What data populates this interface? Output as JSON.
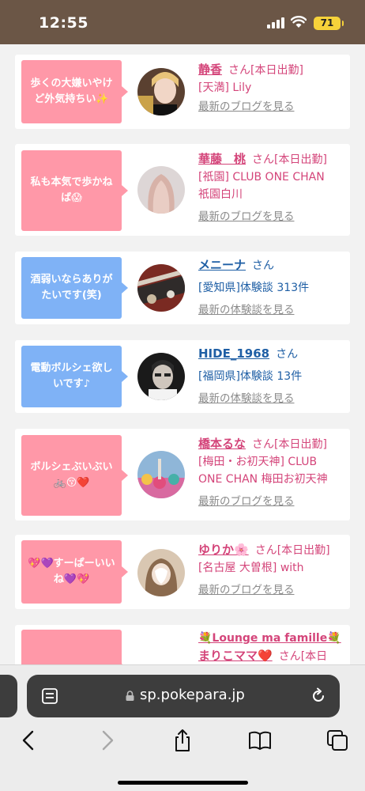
{
  "status": {
    "time": "12:55",
    "battery": "71"
  },
  "cards": [
    {
      "bubble": "歩くの大嫌いやけど外気持ちい✨",
      "name": "静香",
      "san": "さん",
      "tag": "[本日出勤]",
      "store": "[天満] Lily",
      "link": "最新のブログを見る"
    },
    {
      "bubble": "私も本気で歩かねば😱",
      "name": "華藤　桃",
      "san": "さん",
      "tag": "[本日出勤]",
      "store": "[祇園] CLUB ONE CHAN 祇園白川",
      "link": "最新のブログを見る"
    },
    {
      "bubble": "酒弱いならありがたいです(笑)",
      "name": "メニーナ",
      "san": "さん",
      "store": "[愛知県]体験談 313件",
      "link": "最新の体験談を見る"
    },
    {
      "bubble": "電動ボルシェ欲しいです♪",
      "name": "HIDE_1968",
      "san": "さん",
      "store": "[福岡県]体験談 13件",
      "link": "最新の体験談を見る"
    },
    {
      "bubble": "ボルシェぶいぶい🚲😚❤️",
      "name": "橋本るな",
      "san": "さん",
      "tag": "[本日出勤]",
      "store": "[梅田・お初天神] CLUB ONE CHAN 梅田お初天神",
      "link": "最新のブログを見る"
    },
    {
      "bubble": "💖💜すーぱーいいね💜💖",
      "name": "ゆりか🌸",
      "san": "さん",
      "tag": "[本日出勤]",
      "store": "[名古屋 大曽根] with",
      "link": "最新のブログを見る"
    },
    {
      "bubble": "",
      "name": "💐Lounge ma famille💐",
      "name2": "まりこママ❤️",
      "san": "さん",
      "tag": "[本日"
    }
  ],
  "browser": {
    "url": "sp.pokepara.jp"
  }
}
